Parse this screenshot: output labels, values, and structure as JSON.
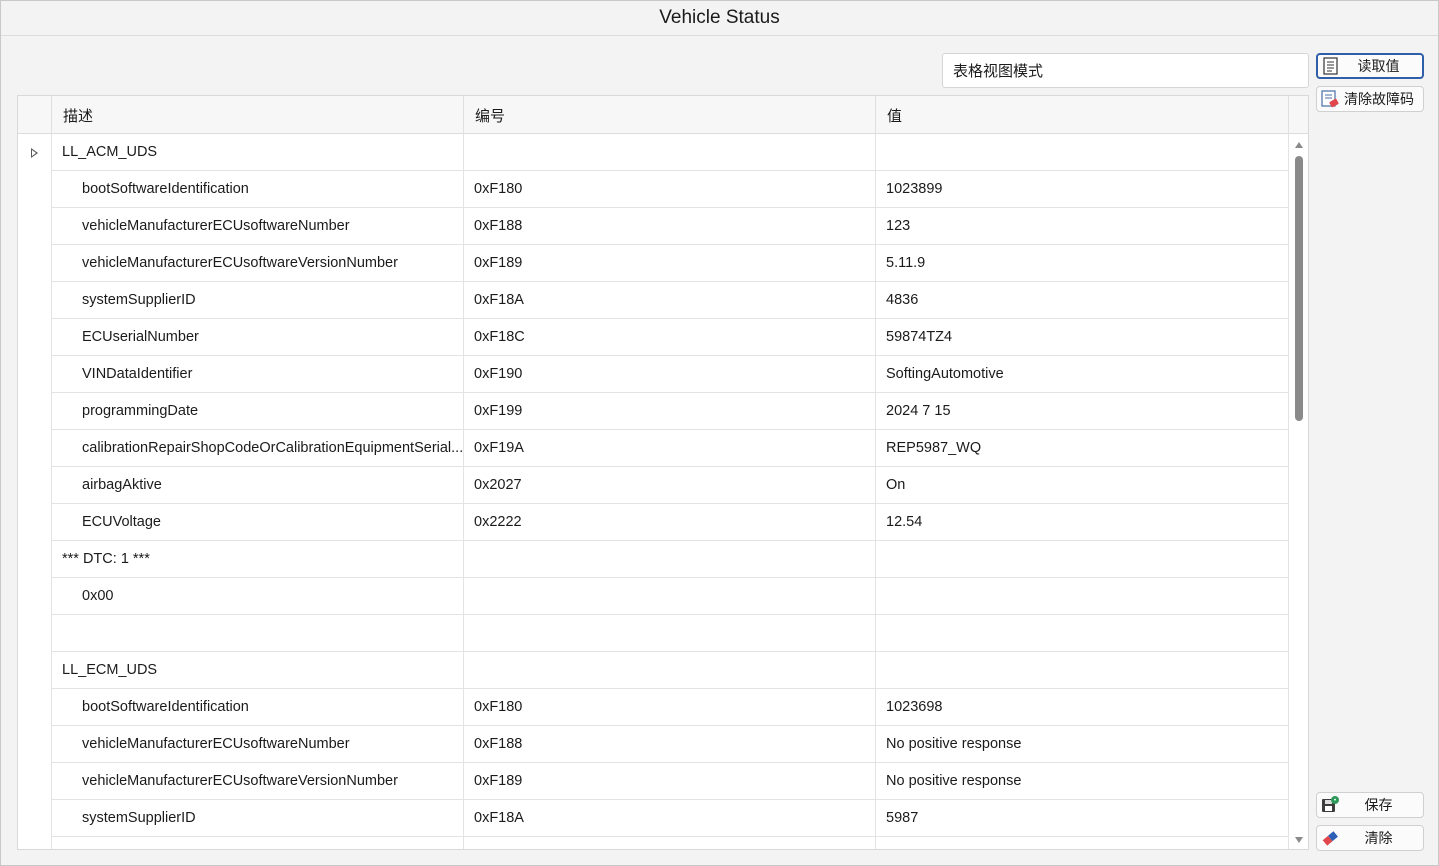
{
  "window": {
    "title": "Vehicle Status"
  },
  "view_mode": {
    "label": "表格视图模式"
  },
  "buttons": {
    "read_values": "读取值",
    "clear_dtc": "清除故障码",
    "save": "保存",
    "clear": "清除"
  },
  "icons": {
    "read_values": "document-list-icon",
    "clear_dtc": "clear-faults-icon",
    "save": "save-disk-icon",
    "clear": "eraser-icon"
  },
  "table": {
    "columns": [
      "描述",
      "编号",
      "值"
    ],
    "rows": [
      {
        "desc": "LL_ACM_UDS",
        "id": "",
        "value": "",
        "level": 0,
        "expander": true
      },
      {
        "desc": "bootSoftwareIdentification",
        "id": "0xF180",
        "value": "1023899",
        "level": 1
      },
      {
        "desc": "vehicleManufacturerECUsoftwareNumber",
        "id": "0xF188",
        "value": "123",
        "level": 1
      },
      {
        "desc": "vehicleManufacturerECUsoftwareVersionNumber",
        "id": "0xF189",
        "value": "5.11.9",
        "level": 1
      },
      {
        "desc": "systemSupplierID",
        "id": "0xF18A",
        "value": "4836",
        "level": 1
      },
      {
        "desc": "ECUserialNumber",
        "id": "0xF18C",
        "value": "59874TZ4",
        "level": 1
      },
      {
        "desc": "VINDataIdentifier",
        "id": "0xF190",
        "value": "SoftingAutomotive",
        "level": 1
      },
      {
        "desc": "programmingDate",
        "id": "0xF199",
        "value": "2024 7 15",
        "level": 1
      },
      {
        "desc": "calibrationRepairShopCodeOrCalibrationEquipmentSerial...",
        "id": "0xF19A",
        "value": "REP5987_WQ",
        "level": 1
      },
      {
        "desc": "airbagAktive",
        "id": "0x2027",
        "value": "On",
        "level": 1
      },
      {
        "desc": "ECUVoltage",
        "id": "0x2222",
        "value": "12.54",
        "level": 1
      },
      {
        "desc": "*** DTC: 1 ***",
        "id": "",
        "value": "",
        "level": 0
      },
      {
        "desc": "0x00",
        "id": "",
        "value": "",
        "level": 1
      },
      {
        "desc": "",
        "id": "",
        "value": "",
        "level": 0
      },
      {
        "desc": "LL_ECM_UDS",
        "id": "",
        "value": "",
        "level": 0
      },
      {
        "desc": "bootSoftwareIdentification",
        "id": "0xF180",
        "value": "1023698",
        "level": 1
      },
      {
        "desc": "vehicleManufacturerECUsoftwareNumber",
        "id": "0xF188",
        "value": "No positive response",
        "level": 1
      },
      {
        "desc": "vehicleManufacturerECUsoftwareVersionNumber",
        "id": "0xF189",
        "value": "No positive response",
        "level": 1
      },
      {
        "desc": "systemSupplierID",
        "id": "0xF18A",
        "value": "5987",
        "level": 1
      },
      {
        "desc": "",
        "id": "",
        "value": "",
        "level": 1
      }
    ]
  }
}
